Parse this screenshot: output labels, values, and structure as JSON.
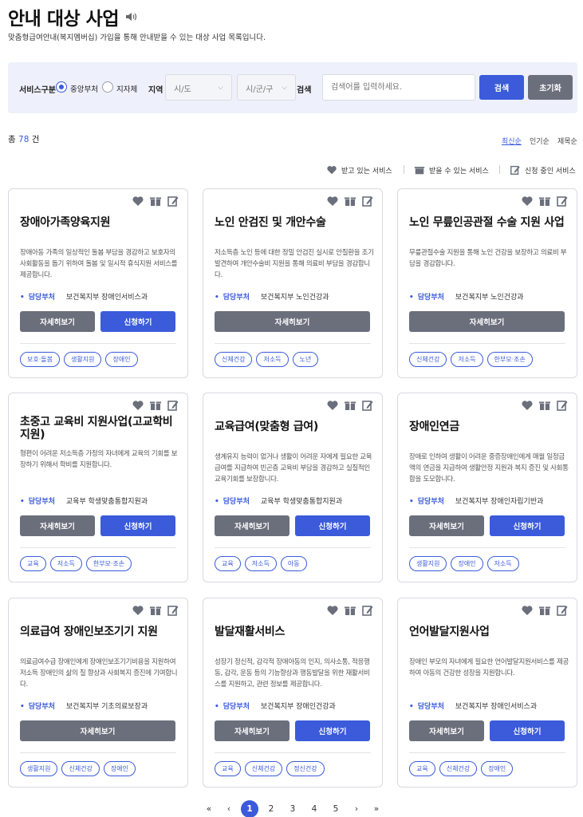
{
  "header": {
    "title": "안내 대상 사업",
    "subtitle": "맞춤형급여안내(복지멤버십) 가입을 통해 안내받을 수 있는 대상 사업 목록입니다."
  },
  "search": {
    "service_type_label": "서비스구분",
    "option_central": "중앙부처",
    "option_local": "지자체",
    "selected": "중앙부처",
    "region_label": "지역",
    "sido": "시/도",
    "sigungu": "시/군/구",
    "keyword_label": "검색",
    "keyword_placeholder": "검색어를 입력하세요.",
    "search_button": "검색",
    "reset_button": "초기화"
  },
  "summary": {
    "total_prefix": "총",
    "total_count": "78",
    "total_suffix": "건"
  },
  "sort": {
    "latest": "최신순",
    "popular": "인기순",
    "title": "제목순",
    "active": "최신순"
  },
  "legend": {
    "receiving": "받고 있는 서비스",
    "eligible": "받을 수 있는 서비스",
    "applying": "신청 중인 서비스"
  },
  "labels": {
    "dept": "담당부처",
    "detail": "자세히보기",
    "apply": "신청하기"
  },
  "cards": [
    {
      "title": "장애아가족양육지원",
      "desc": "장애아동 가족의 일상적인 돌봄 부담을 경감하고 보호자의 사회활동을 돕기 위하여 돌봄 및 일시적 휴식지원 서비스를 제공합니다.",
      "dept": "보건복지부 장애인서비스과",
      "apply": true,
      "tags": [
        "보호·돌봄",
        "생활지원",
        "장애인"
      ]
    },
    {
      "title": "노인 안검진 및 개안수술",
      "desc": "저소득층 노인 등에 대한 정밀 안검진 실시로 안질환을 조기 발견하여 개안수술비 지원을 통해 의료비 부담을 경감합니다.",
      "dept": "보건복지부 노인건강과",
      "apply": false,
      "tags": [
        "신체건강",
        "저소득",
        "노년"
      ]
    },
    {
      "title": "노인 무릎인공관절 수술 지원 사업",
      "desc": "무릎관절수술 지원을 통해 노인 건강을 보장하고 의료비 부담을 경감합니다.",
      "dept": "보건복지부 노인건강과",
      "apply": false,
      "tags": [
        "신체건강",
        "저소득",
        "한부모·조손"
      ]
    },
    {
      "title": "초중고  교육비  지원사업(고교학비지원)",
      "desc": "형편이 어려운 저소득층 가정의 자녀에게 교육의 기회를 보장하기 위해서 학비를 지원합니다.",
      "dept": "교육부 학생맞춤통합지원과",
      "apply": true,
      "tags": [
        "교육",
        "저소득",
        "한부모·조손"
      ]
    },
    {
      "title": "교육급여(맞춤형 급여)",
      "desc": "생계유지 능력이 없거나 생활이 어려운 자에게 필요한 교육급여를 지급하여 빈곤층 교육비 부담을 경감하고 실질적인 교육기회를 보장합니다.",
      "dept": "교육부 학생맞춤통합지원과",
      "apply": true,
      "tags": [
        "교육",
        "저소득",
        "아동"
      ]
    },
    {
      "title": "장애인연금",
      "desc": "장애로 인하여 생활이 어려운 중증장애인에게 매월 일정금액의 연금을 지급하여 생활안정 지원과 복지 증진 및 사회통합을 도모합니다.",
      "dept": "보건복지부 장애인자립기반과",
      "apply": true,
      "tags": [
        "생활지원",
        "장애인",
        "저소득"
      ]
    },
    {
      "title": "의료급여 장애인보조기기 지원",
      "desc": "의료급여수급 장애인에게 장애인보조기기비용을 지원하여 저소득 장애인의 삶의 질 향상과 사회복지 증진에 기여합니다.",
      "dept": "보건복지부 기초의료보장과",
      "apply": false,
      "tags": [
        "생활지원",
        "신체건강",
        "장애인"
      ]
    },
    {
      "title": "발달재활서비스",
      "desc": "성장기 정신적, 감각적 장애아동의 인지, 의사소통, 적응행동, 감각, 운동 등의 기능향상과 행동발달을 위한 재활서비스를 지원하고, 관련 정보를 제공합니다.",
      "dept": "보건복지부 장애인건강과",
      "apply": true,
      "tags": [
        "교육",
        "신체건강",
        "정신건강"
      ]
    },
    {
      "title": "언어발달지원사업",
      "desc": "장애인 부모의 자녀에게 필요한 언어발달지원서비스를 제공하여 아동의 건강한 성장을 지원합니다.",
      "dept": "보건복지부 장애인서비스과",
      "apply": true,
      "tags": [
        "교육",
        "신체건강",
        "장애인"
      ]
    }
  ],
  "pagination": {
    "first": "«",
    "prev": "‹",
    "pages": [
      "1",
      "2",
      "3",
      "4",
      "5"
    ],
    "current": "1",
    "next": "›",
    "last": "»"
  },
  "colors": {
    "accent": "#3b5bdb",
    "secondary": "#6b6f7c",
    "search_bg": "#eef1fb"
  }
}
